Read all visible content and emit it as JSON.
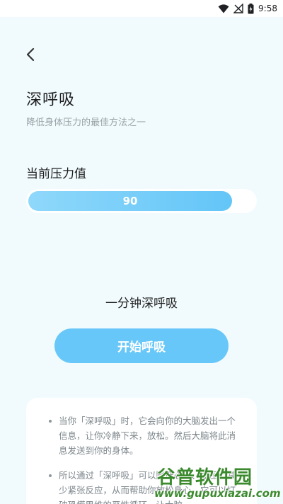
{
  "status_bar": {
    "time": "9:58",
    "icons": [
      "wifi-icon",
      "signal-off-icon",
      "battery-charging-icon"
    ]
  },
  "header": {
    "back_icon": "chevron-left-icon",
    "title": "深呼吸",
    "subtitle": "降低身体压力的最佳方法之一"
  },
  "stress": {
    "label": "当前压力值",
    "value": "90",
    "level_percent": 90
  },
  "breathing": {
    "label": "一分钟深呼吸",
    "start_button": "开始呼吸"
  },
  "info": {
    "items": [
      "当你「深呼吸」时，它会向你的大脑发出一个信息，让你冷静下来，放松。然后大脑将此消息发送到你的身体。",
      "所以通过「深呼吸」可以降低心率、血压及减少紧张反应，从而帮助你放松身心。它可以打破恐慌思维的恶性循环，让大脑"
    ]
  },
  "watermark": {
    "logo": "谷普软件园",
    "url": "www.gupuxiazai.com"
  },
  "colors": {
    "background": "#f1fbfd",
    "accent": "#68c7f9",
    "brand_watermark": "#3b8a2e"
  }
}
